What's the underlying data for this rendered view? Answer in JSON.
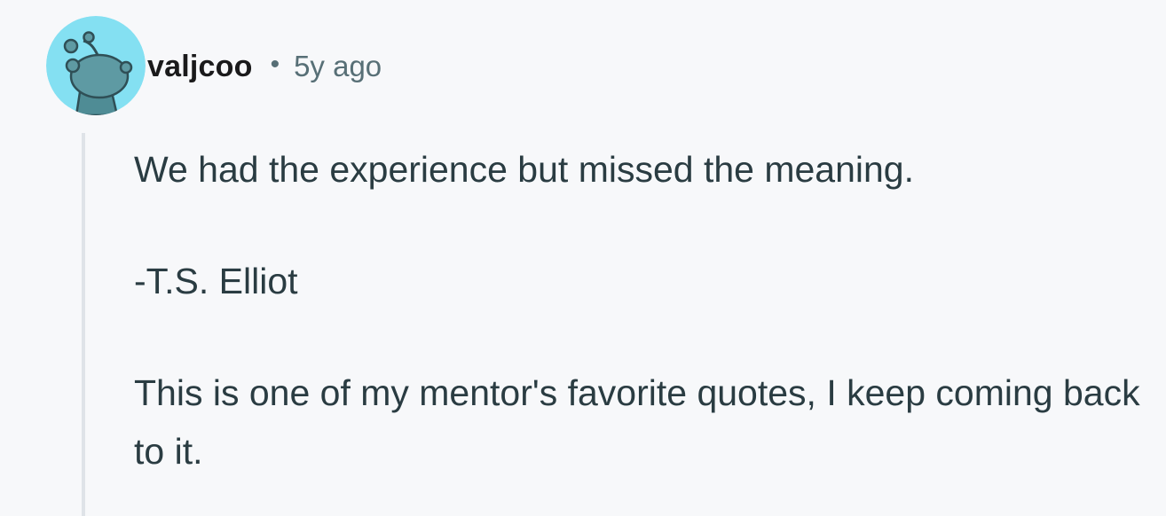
{
  "comment": {
    "author": "valjcoo",
    "separator": "•",
    "time_ago": "5y ago",
    "avatar_icon": "reddit-snoo-avatar-icon",
    "avatar_bg": "#84e0f2",
    "paragraphs": [
      "We had the experience but missed the meaning.",
      "-T.S. Elliot",
      "This is one of my mentor's favorite quotes, I keep coming back to it."
    ]
  }
}
